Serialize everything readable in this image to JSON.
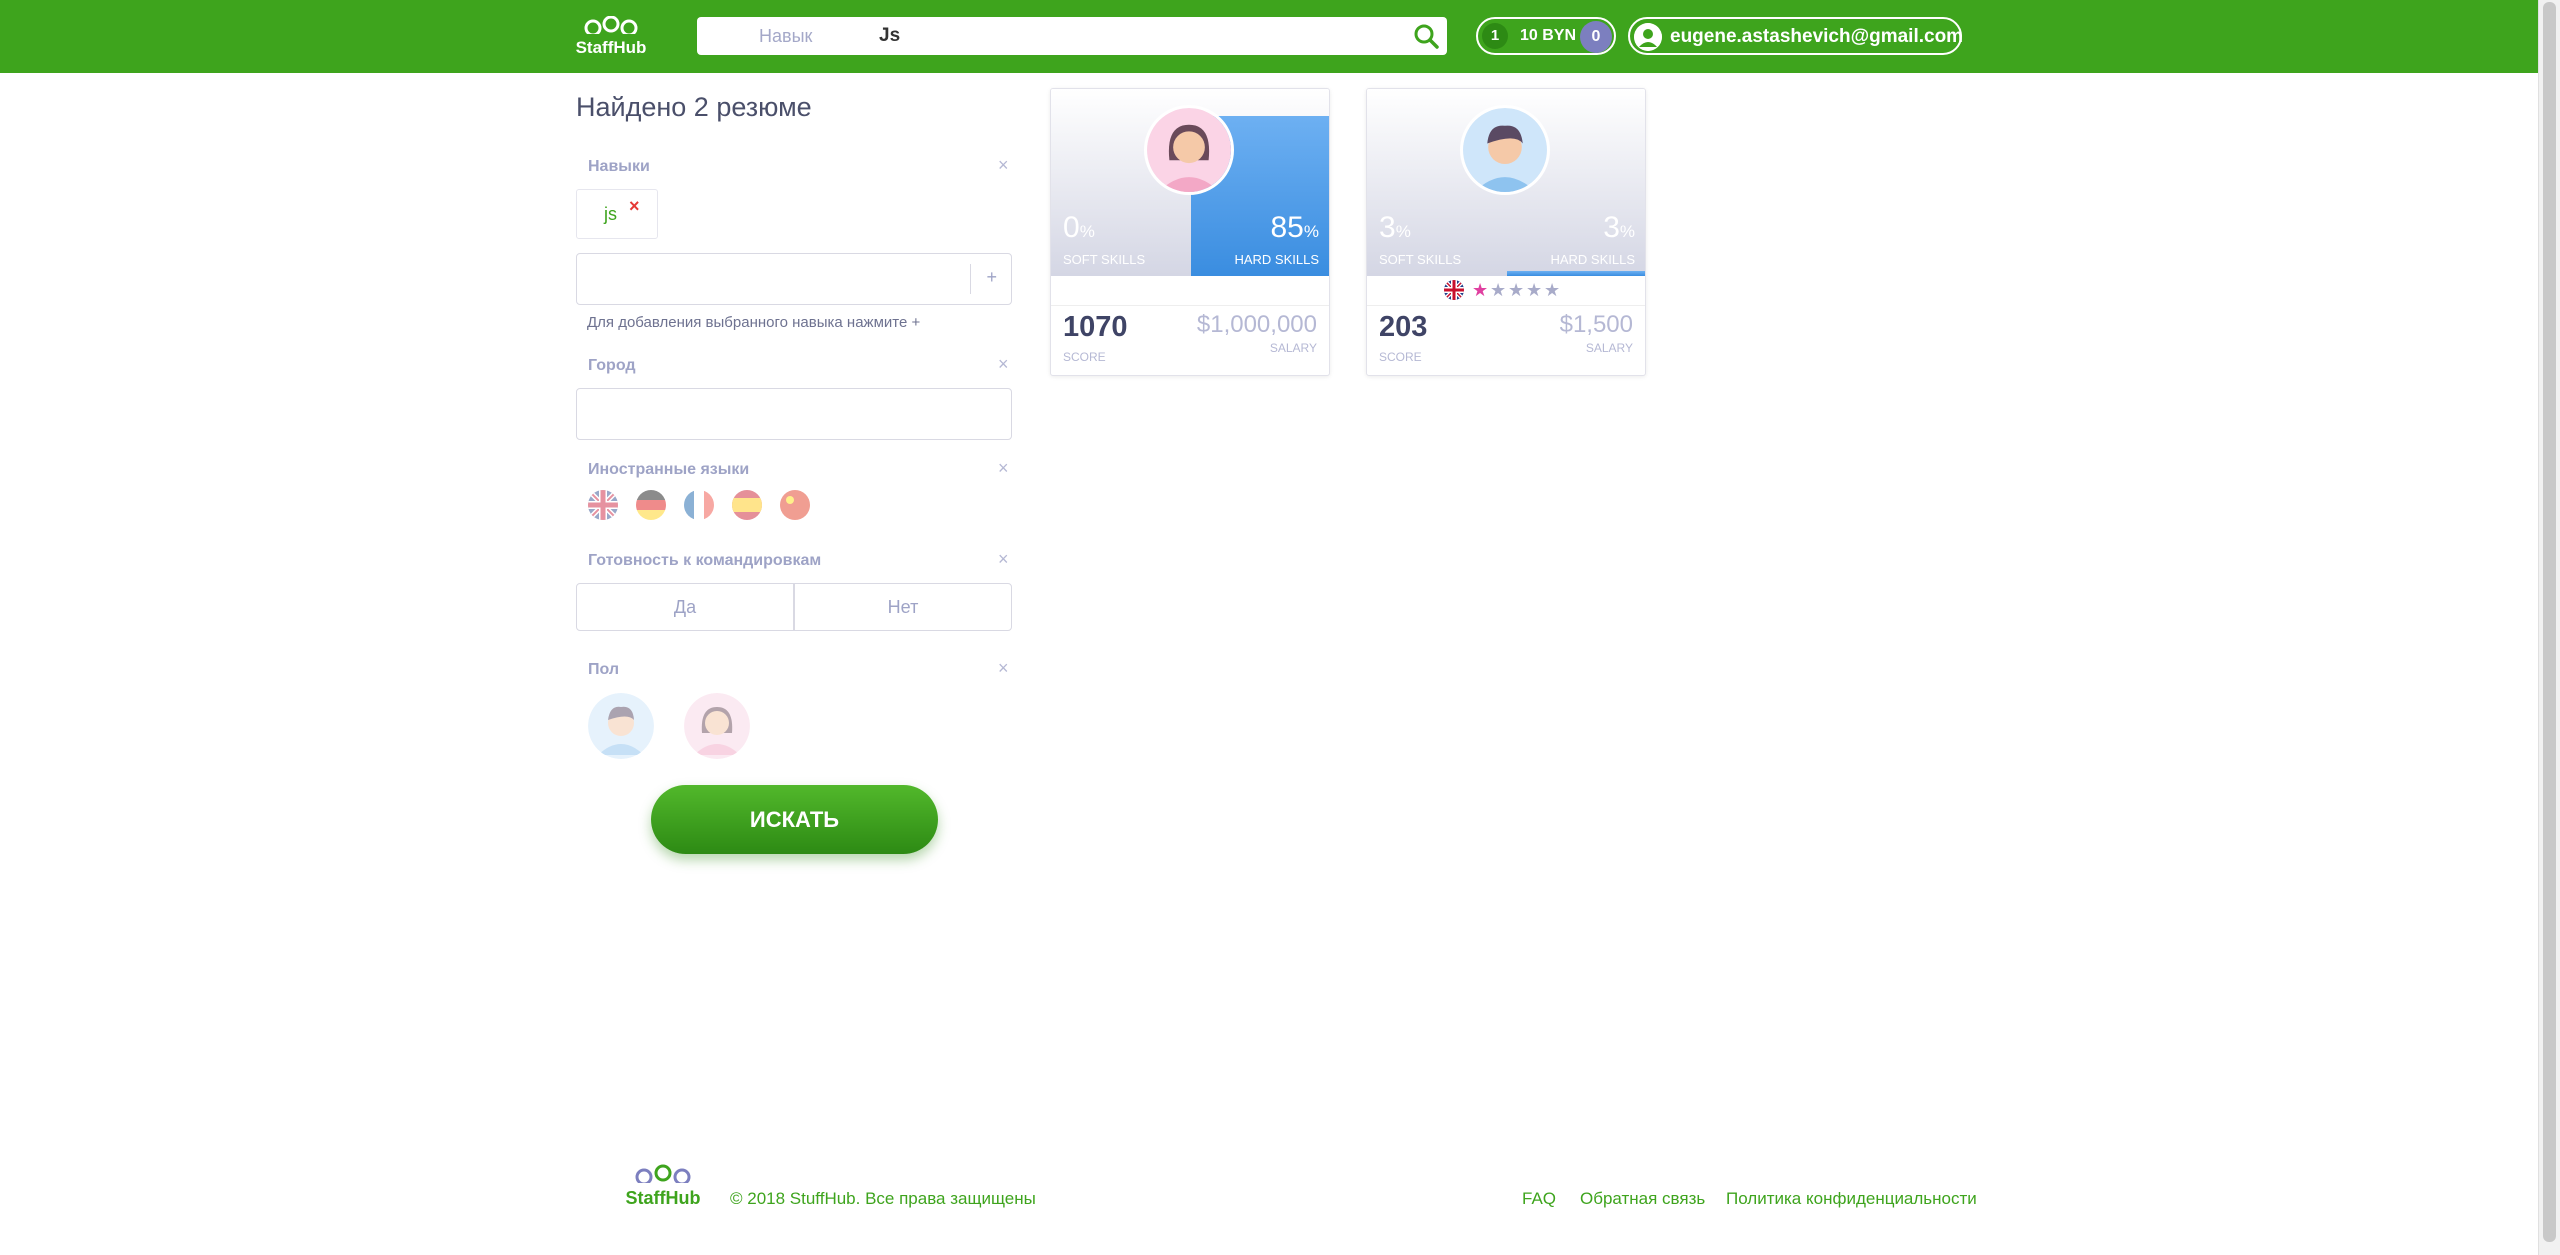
{
  "header": {
    "logo_text": "StaffHub",
    "search": {
      "category": "Навык",
      "query": "Js"
    },
    "balance": {
      "badge": "1",
      "amount": "10 BYN",
      "count": "0"
    },
    "user_email": "eugene.astashevich@gmail.com"
  },
  "results_title": "Найдено 2 резюме",
  "filters": {
    "skills": {
      "label": "Навыки",
      "chips": [
        "js"
      ],
      "add_symbol": "+",
      "hint": "Для добавления выбранного навыка нажмите +"
    },
    "city": {
      "label": "Город"
    },
    "languages": {
      "label": "Иностранные языки",
      "flags": [
        "uk-flag-icon",
        "germany-flag-icon",
        "france-flag-icon",
        "spain-flag-icon",
        "china-flag-icon"
      ]
    },
    "travel": {
      "label": "Готовность к командировкам",
      "yes": "Да",
      "no": "Нет"
    },
    "gender": {
      "label": "Пол"
    },
    "close_symbol": "×",
    "search_button": "ИСКАТЬ"
  },
  "cards": [
    {
      "avatar": "female-avatar-icon",
      "soft_pct": "0",
      "hard_pct": "85",
      "hard_fraction": 1.0,
      "soft_label": "SOFT SKILLS",
      "hard_label": "HARD SKILLS",
      "score": "1070",
      "score_label": "SCORE",
      "salary": "$1,000,000",
      "salary_label": "SALARY",
      "languages": []
    },
    {
      "avatar": "male-avatar-icon",
      "soft_pct": "3",
      "hard_pct": "3",
      "hard_fraction": 0.03,
      "soft_label": "SOFT SKILLS",
      "hard_label": "HARD SKILLS",
      "score": "203",
      "score_label": "SCORE",
      "salary": "$1,500",
      "salary_label": "SALARY",
      "languages": [
        {
          "flag": "uk-flag-icon",
          "rating": 1,
          "max": 5
        }
      ]
    }
  ],
  "footer": {
    "logo_text": "StaffHub",
    "copyright": "© 2018 StuffHub. Все права защищены",
    "links": [
      "FAQ",
      "Обратная связь",
      "Политика конфиденциальности"
    ]
  },
  "colors": {
    "brand_green": "#3ea41d",
    "hard_skill_blue": "#3a8de0",
    "muted_label": "#9ea3c6",
    "rating_pink": "#e040a0"
  }
}
